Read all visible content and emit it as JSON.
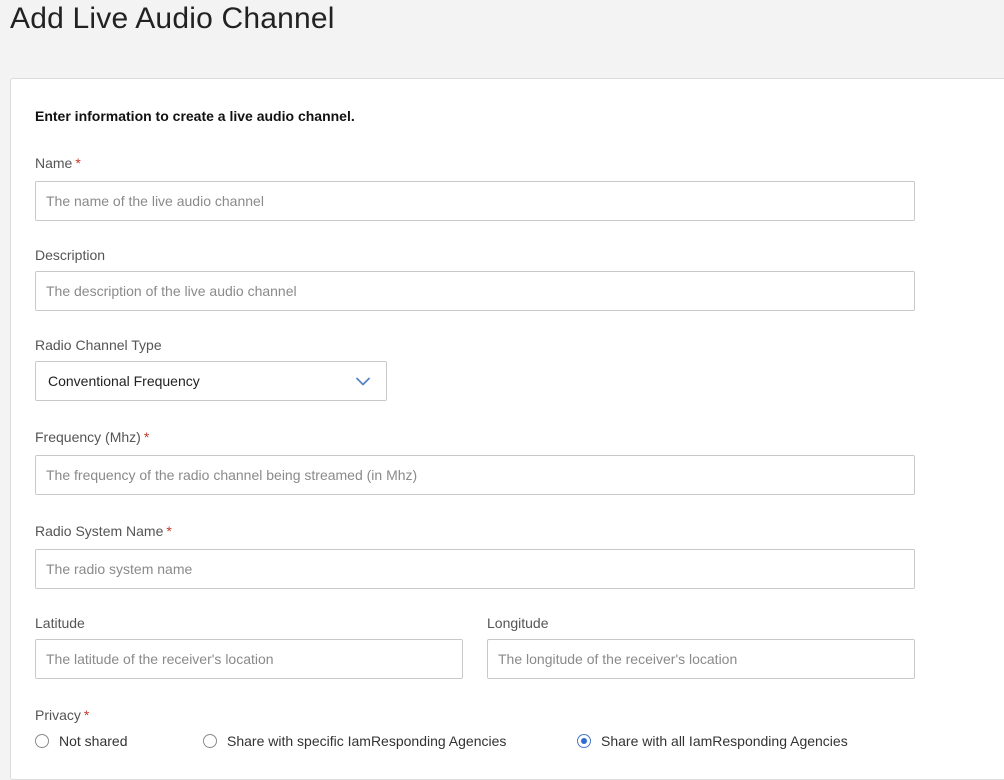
{
  "page": {
    "title": "Add Live Audio Channel"
  },
  "form": {
    "intro": "Enter information to create a live audio channel.",
    "required_mark": "*",
    "name": {
      "label": "Name",
      "required": true,
      "placeholder": "The name of the live audio channel",
      "value": ""
    },
    "description": {
      "label": "Description",
      "required": false,
      "placeholder": "The description of the live audio channel",
      "value": ""
    },
    "radio_channel_type": {
      "label": "Radio Channel Type",
      "selected": "Conventional Frequency",
      "icon": "chevron-down-icon"
    },
    "frequency": {
      "label": "Frequency (Mhz)",
      "required": true,
      "placeholder": "The frequency of the radio channel being streamed (in Mhz)",
      "value": ""
    },
    "radio_system_name": {
      "label": "Radio System Name",
      "required": true,
      "placeholder": "The radio system name",
      "value": ""
    },
    "latitude": {
      "label": "Latitude",
      "required": false,
      "placeholder": "The latitude of the receiver's location",
      "value": ""
    },
    "longitude": {
      "label": "Longitude",
      "required": false,
      "placeholder": "The longitude of the receiver's location",
      "value": ""
    },
    "privacy": {
      "label": "Privacy",
      "required": true,
      "options": [
        {
          "label": "Not shared",
          "checked": false
        },
        {
          "label": "Share with specific IamResponding Agencies",
          "checked": false
        },
        {
          "label": "Share with all IamResponding Agencies",
          "checked": true
        }
      ]
    }
  },
  "colors": {
    "accent": "#2f6cd0",
    "required": "#c0392b",
    "page_bg": "#f3f3f3"
  }
}
